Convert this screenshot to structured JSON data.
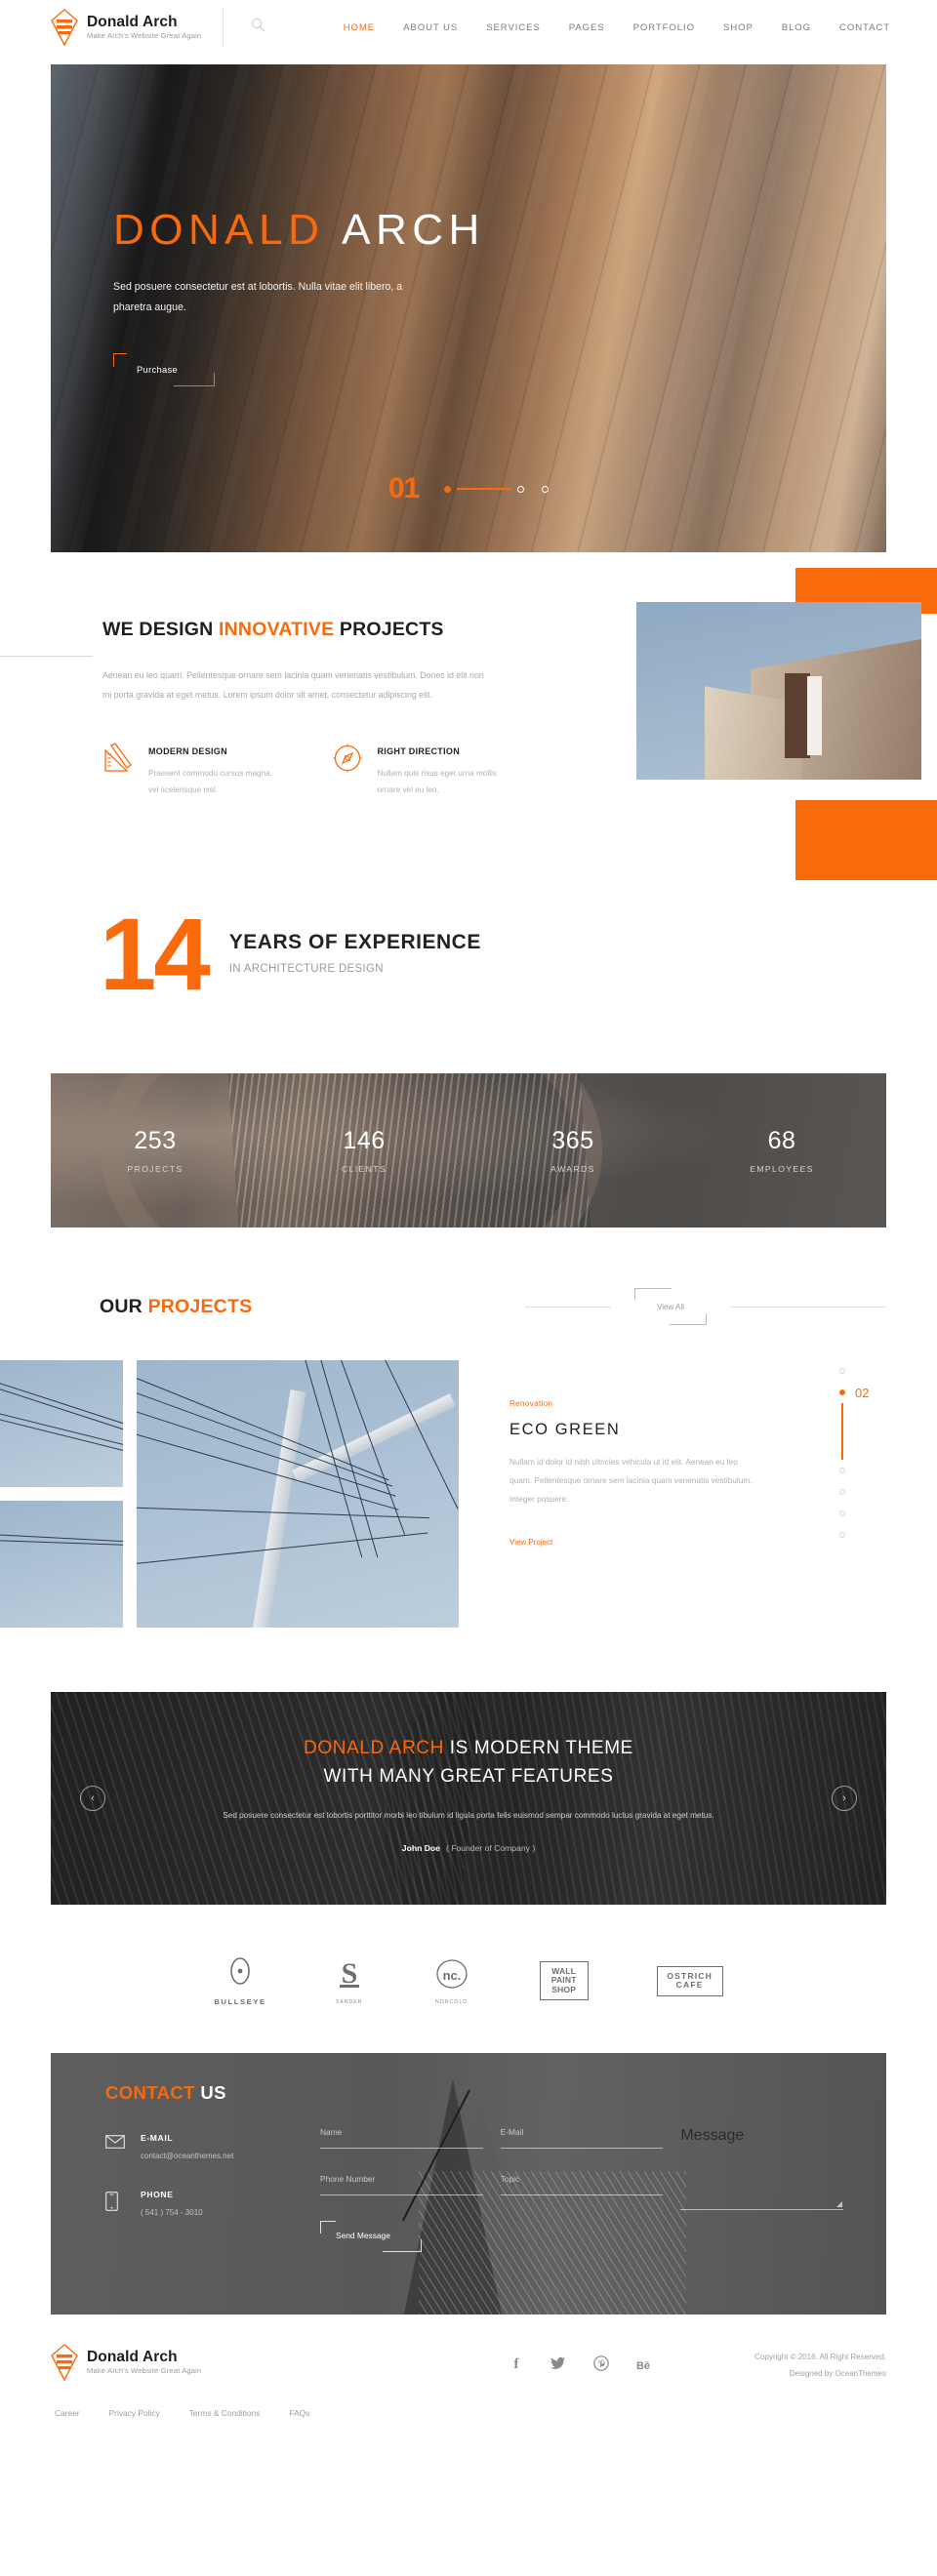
{
  "brand": {
    "name": "Donald Arch",
    "tagline": "Make Arch's Website Great Again",
    "logo_icon": "diamond-arch-logo-icon"
  },
  "header": {
    "search_icon": "search-icon",
    "nav": [
      {
        "label": "HOME",
        "active": true
      },
      {
        "label": "ABOUT US",
        "active": false
      },
      {
        "label": "SERVICES",
        "active": false
      },
      {
        "label": "PAGES",
        "active": false
      },
      {
        "label": "PORTFOLIO",
        "active": false
      },
      {
        "label": "SHOP",
        "active": false
      },
      {
        "label": "BLOG",
        "active": false
      },
      {
        "label": "CONTACT",
        "active": false
      }
    ]
  },
  "hero": {
    "title_orange": "DONALD",
    "title_white": "ARCH",
    "subtitle": "Sed posuere consectetur est at lobortis. Nulla vitae elit libero, a pharetra augue.",
    "button": "Purchase",
    "slide_number": "01",
    "slides": 3,
    "active_slide": 1
  },
  "design": {
    "heading_pre": "WE DESIGN ",
    "heading_highlight": "INNOVATIVE",
    "heading_post": " PROJECTS",
    "paragraph": "Aenean eu leo quam. Pellentesque ornare sem lacinia quam venenatis vestibulum. Donec id elit non mi porta gravida at eget metus. Lorem ipsum dolor sit amet, consectetur adipiscing elit.",
    "features": [
      {
        "icon": "ruler-pencil-icon",
        "title": "MODERN DESIGN",
        "desc": "Praesent commodo cursus magna, vel scelerisque nisl."
      },
      {
        "icon": "compass-icon",
        "title": "RIGHT DIRECTION",
        "desc": "Nullam quis risus eget urna mollis ornare vel eu leo."
      }
    ]
  },
  "years": {
    "number": "14",
    "heading": "YEARS OF EXPERIENCE",
    "subheading": "IN ARCHITECTURE DESIGN"
  },
  "counters": [
    {
      "number": "253",
      "label": "PROJECTS"
    },
    {
      "number": "146",
      "label": "CLIENTS"
    },
    {
      "number": "365",
      "label": "AWARDS"
    },
    {
      "number": "68",
      "label": "EMPLOYEES"
    }
  ],
  "projects": {
    "heading_pre": "OUR ",
    "heading_highlight": "PROJECTS",
    "view_all": "View All",
    "category": "Renovation",
    "title": "ECO GREEN",
    "desc": "Nullam id dolor id nibh ultricies vehicula ut id elit. Aenean eu leo quam. Pellentesque ornare sem lacinia quam venenatis vestibulum. Integer posuere.",
    "view_project": "View Project",
    "pager_number": "02",
    "pager_dots": 7,
    "pager_active": 2
  },
  "testimonial": {
    "heading_orange": "DONALD ARCH",
    "heading_rest": " IS MODERN THEME",
    "heading_line2": "WITH MANY GREAT FEATURES",
    "quote": "Sed posuere consectetur est lobortis porttitor morbi leo tibulum id ligula porta felis euismod sempar commodo luctus gravida at eget metus.",
    "author": "John Doe",
    "author_role": "( Founder of Company )",
    "prev_icon": "chevron-left-icon",
    "next_icon": "chevron-right-icon"
  },
  "clients": [
    {
      "icon": "bullseye-oval-icon",
      "name": "BULLSEYE",
      "sub": ""
    },
    {
      "icon": "letter-s-icon",
      "name": "",
      "sub": "SANDER"
    },
    {
      "icon": "nc-circle-icon",
      "name": "",
      "sub": "NORCOLO"
    },
    {
      "icon": "boxed-wordmark-icon",
      "name": "WALL PAINT SHOP",
      "sub": ""
    },
    {
      "icon": "boxed-wordmark-icon",
      "name": "OSTRICH CAFE",
      "sub": ""
    }
  ],
  "contact": {
    "heading_orange": "CONTACT",
    "heading_white": " US",
    "email_icon": "envelope-icon",
    "email_label": "E-MAIL",
    "email_value": "contact@oceanthemes.net",
    "phone_icon": "mobile-phone-icon",
    "phone_label": "PHONE",
    "phone_value": "( 541 ) 754 - 3010",
    "fields": {
      "name": "Name",
      "email": "E-Mail",
      "phone": "Phone Number",
      "topic": "Topic",
      "message": "Message"
    },
    "submit": "Send Message"
  },
  "footer": {
    "social": [
      {
        "icon": "facebook-icon",
        "glyph": "f"
      },
      {
        "icon": "twitter-icon",
        "glyph": "t"
      },
      {
        "icon": "pinterest-icon",
        "glyph": "p"
      },
      {
        "icon": "behance-icon",
        "glyph": "Bē"
      }
    ],
    "copyright": "Copyright © 2016. All Right Reserved.",
    "designed_by": "Designed by OceanThemes",
    "links": [
      "Career",
      "Privacy Policy",
      "Terms & Conditions",
      "FAQs"
    ]
  },
  "colors": {
    "accent": "#f96a0d",
    "dark": "#1f1f1f",
    "muted": "#a9a9a9"
  }
}
